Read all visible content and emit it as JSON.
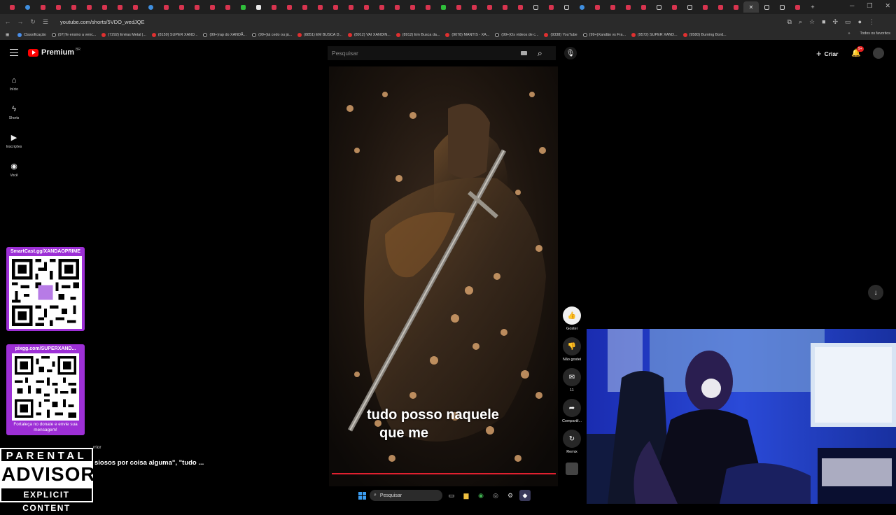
{
  "browser": {
    "url": "youtube.com/shorts/5VDO_wedJQE",
    "bookmarks": [
      {
        "label": "Classificação",
        "kind": "gl"
      },
      {
        "label": "(97)Te ensino a venc...",
        "kind": "tk"
      },
      {
        "label": "(7292) Enéas Metal |...",
        "kind": "yt"
      },
      {
        "label": "(8159) SUPER XAND...",
        "kind": "yt"
      },
      {
        "label": "(99+)rap do XANDÃ...",
        "kind": "tk"
      },
      {
        "label": "(99+)tá cedo ou já...",
        "kind": "tk"
      },
      {
        "label": "(8851) EM BUSCA D...",
        "kind": "yt"
      },
      {
        "label": "(8912) VAI XANDIN...",
        "kind": "yt"
      },
      {
        "label": "(8912) Em Busca da...",
        "kind": "yt"
      },
      {
        "label": "(9078) MANTIS - XA...",
        "kind": "yt"
      },
      {
        "label": "(99+)Os vídeos de c...",
        "kind": "tk"
      },
      {
        "label": "(9338) YouTube",
        "kind": "yt"
      },
      {
        "label": "(99+)Xandão vs Fra...",
        "kind": "tk"
      },
      {
        "label": "(9572) SUPER XAND...",
        "kind": "yt"
      },
      {
        "label": "(9580) Burning Bord...",
        "kind": "yt"
      }
    ],
    "bookmarks_more": "»",
    "all_favorites": "Todos os favoritos"
  },
  "youtube": {
    "logo_text": "Premium",
    "country": "BR",
    "search_placeholder": "Pesquisar",
    "create_label": "Criar",
    "notif_count": "9+",
    "sidebar": [
      {
        "label": "Início",
        "icon": "⌂"
      },
      {
        "label": "Shorts",
        "icon": "ϟ"
      },
      {
        "label": "Inscrições",
        "icon": "▶"
      },
      {
        "label": "Você",
        "icon": "◉"
      }
    ],
    "actions": [
      {
        "label": "Gostei",
        "icon": "👍"
      },
      {
        "label": "Não gostei",
        "icon": "👎"
      },
      {
        "label": "11",
        "icon": "✉"
      },
      {
        "label": "Compartil...",
        "icon": "➦"
      },
      {
        "label": "Remix",
        "icon": "↻"
      }
    ]
  },
  "short": {
    "caption_line1": "tudo posso naquele",
    "caption_line2": "que me",
    "channel_fragment": "rrior",
    "description": "siosos por coisa alguma\", \"tudo ..."
  },
  "stream_overlay": {
    "qr1_title": "SmartCast.gg/XANDAOPRIME",
    "qr2_title": "pixgg.com/SUPERXAND...",
    "qr2_footer": "Fortaleça no donate e envie sua mensagem!",
    "advisory_line1": "PARENTAL",
    "advisory_line2": "ADVISORY",
    "advisory_line3": "EXPLICIT CONTENT"
  },
  "taskbar": {
    "search_label": "Pesquisar"
  },
  "colors": {
    "youtube_red": "#ff0000",
    "overlay_purple": "#9d2fd6",
    "progress_red": "#e0202f"
  }
}
